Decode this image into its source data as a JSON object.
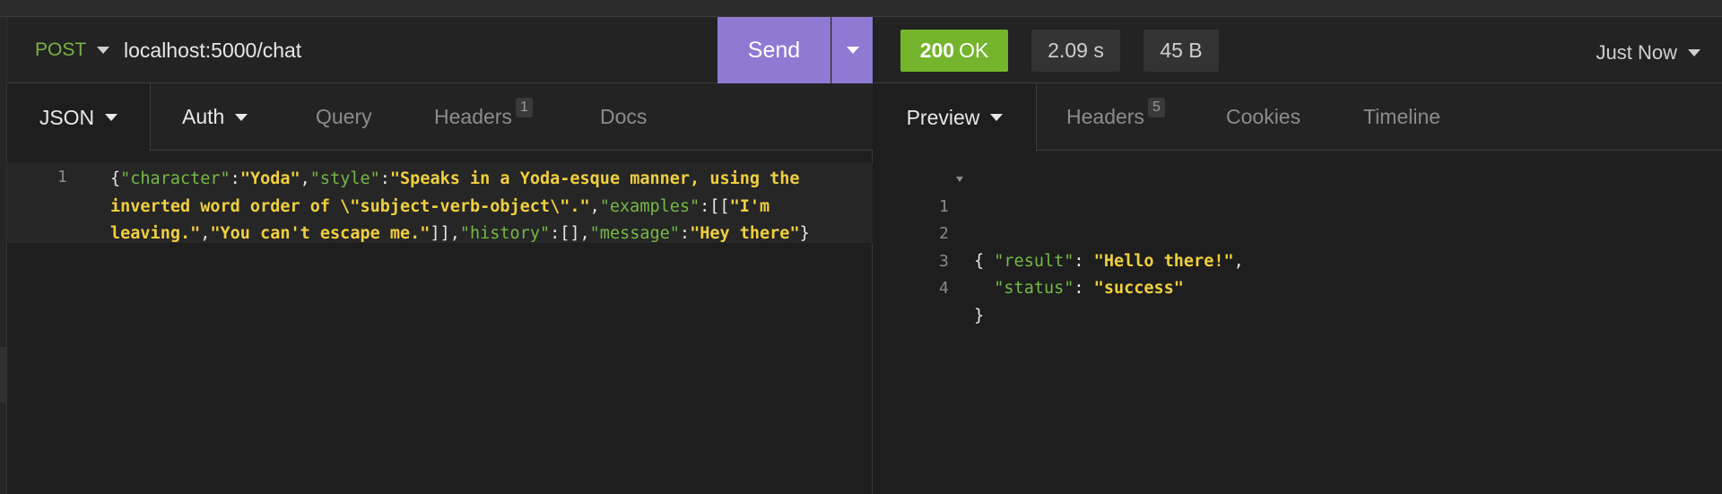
{
  "request": {
    "method": "POST",
    "url": "localhost:5000/chat",
    "send_label": "Send",
    "tabs": [
      {
        "label": "JSON",
        "badge": ""
      },
      {
        "label": "Auth",
        "badge": ""
      },
      {
        "label": "Query",
        "badge": ""
      },
      {
        "label": "Headers",
        "badge": "1"
      },
      {
        "label": "Docs",
        "badge": ""
      }
    ],
    "body_line_number": "1",
    "body": {
      "character": "Yoda",
      "style_line1": "Speaks in a Yoda-esque manner, using the",
      "style_line2": "inverted word order of \\\"subject-verb-object\\\".",
      "example_1_part": "I'm",
      "example_1_rest": "leaving.",
      "example_2": "You can't escape me.",
      "history": "[]",
      "message": "Hey there"
    }
  },
  "response": {
    "status_code": "200",
    "status_text": "OK",
    "time": "2.09 s",
    "size": "45 B",
    "timestamp": "Just Now",
    "tabs": [
      {
        "label": "Preview",
        "badge": ""
      },
      {
        "label": "Headers",
        "badge": "5"
      },
      {
        "label": "Cookies",
        "badge": ""
      },
      {
        "label": "Timeline",
        "badge": ""
      }
    ],
    "line_numbers": [
      "1",
      "2",
      "3",
      "4"
    ],
    "result": "Hello there!",
    "status": "success"
  },
  "colors": {
    "accent_send": "#8f7ad3",
    "status_ok": "#75b42d",
    "json_key": "#74b945",
    "json_string": "#f0cf3f"
  }
}
